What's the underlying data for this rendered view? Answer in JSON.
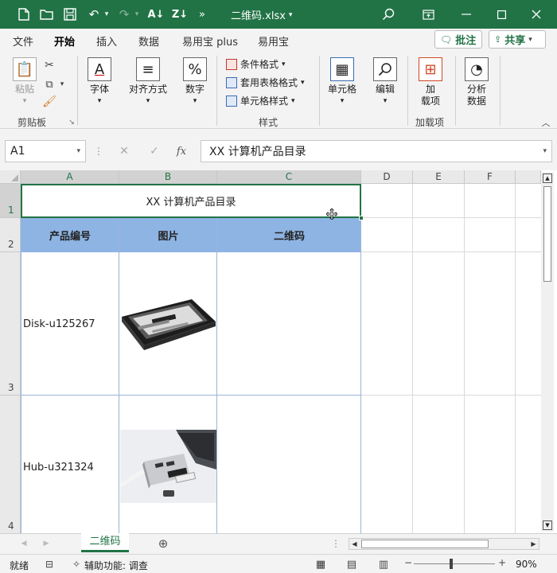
{
  "titlebar": {
    "filename": "二维码.xlsx",
    "colors": {
      "accent": "#217346"
    }
  },
  "tabs": [
    "文件",
    "开始",
    "插入",
    "数据",
    "易用宝 plus",
    "易用宝"
  ],
  "header_buttons": {
    "comment": "批注",
    "share": "共享"
  },
  "ribbon": {
    "paste": "粘贴",
    "clipboard_group": "剪贴板",
    "font": "字体",
    "align": "对齐方式",
    "number": "数字",
    "cond_format": "条件格式",
    "table_format": "套用表格格式",
    "cell_style": "单元格样式",
    "styles_group": "样式",
    "cells": "单元格",
    "edit": "编辑",
    "addins_line1": "加",
    "addins_line2": "载项",
    "addins_group": "加载项",
    "analyze_line1": "分析",
    "analyze_line2": "数据"
  },
  "formula_bar": {
    "name_box": "A1",
    "formula": "XX 计算机产品目录"
  },
  "grid": {
    "columns": [
      "A",
      "B",
      "C",
      "D",
      "E",
      "F"
    ],
    "rows": [
      "1",
      "2",
      "3",
      "4"
    ],
    "title": "XX 计算机产品目录",
    "headers": [
      "产品编号",
      "图片",
      "二维码"
    ],
    "items": [
      {
        "code": "Disk-u125267"
      },
      {
        "code": "Hub-u321324"
      }
    ],
    "header_fill": "#8eb4e3"
  },
  "sheet": {
    "active_tab": "二维码"
  },
  "status": {
    "ready": "就绪",
    "accessibility": "辅助功能: 调查",
    "zoom": "90%"
  }
}
